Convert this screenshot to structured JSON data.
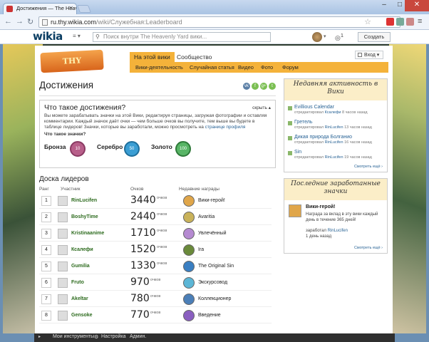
{
  "browser": {
    "tab_title": "Достижения — The Heavenly",
    "url_main": "ru.thy.wikia.com",
    "url_path": "/wiki/Служебная:Leaderboard",
    "min": "–",
    "max": "□",
    "close": "✕"
  },
  "wikia": {
    "logo": "wikia",
    "search_placeholder": "Поиск внутри The Heavenly Yard вики...",
    "notif_count": "1",
    "create_wiki": "Создать вики"
  },
  "wiki": {
    "logo_text": "THY",
    "tabs": [
      "На этой вики",
      "Сообщество"
    ],
    "subnav": [
      "Вики-деятельность",
      "Случайная статья",
      "Видео",
      "Фото",
      "Форум"
    ],
    "login": "Вход"
  },
  "content": {
    "title": "Достижения",
    "social": [
      "vk",
      "f",
      "g+",
      "t"
    ],
    "what": {
      "title": "Что такое достижения?",
      "hide": "скрыть",
      "desc": "Вы можете зарабатывать значки на этой Вики, редактируя страницы, загружая фотографии и оставляя комментарии. Каждый значок даёт очки — чем больше очков вы получите, тем выше вы будете в таблице лидеров! Значки, которые вы заработали, можно просмотреть на ",
      "desc_link": "странице профиля",
      "sub": "Что такое значки?",
      "medals": [
        {
          "label": "Бронза",
          "badge": "10",
          "color": "#b85f8a"
        },
        {
          "label": "Серебро",
          "badge": "50",
          "color": "#3b9ed4"
        },
        {
          "label": "Золото",
          "badge": "100",
          "color": "#58b566"
        }
      ]
    },
    "leaderboard": {
      "title": "Доска лидеров",
      "headers": {
        "rank": "Ранг",
        "user": "Участник",
        "points": "Очков",
        "recent": "Недавние награды"
      },
      "points_label": "очков",
      "rows": [
        {
          "rank": "1",
          "user": "RinLucifen",
          "points": "3440",
          "badge": "Вики-герой!",
          "bcolor": "#e0a64a"
        },
        {
          "rank": "2",
          "user": "BoshyTime",
          "points": "2440",
          "badge": "Avaritia",
          "bcolor": "#c9b25a"
        },
        {
          "rank": "3",
          "user": "Kristinaanime",
          "points": "1710",
          "badge": "Увлечённый",
          "bcolor": "#b58ad1"
        },
        {
          "rank": "4",
          "user": "Ксалефи",
          "points": "1520",
          "badge": "Ira",
          "bcolor": "#6a8a3a"
        },
        {
          "rank": "5",
          "user": "Gumilia",
          "points": "1330",
          "badge": "The Original Sin",
          "bcolor": "#3a7fc2"
        },
        {
          "rank": "6",
          "user": "Fruto",
          "points": "970",
          "badge": "Экскурсовод",
          "bcolor": "#5cb6d6"
        },
        {
          "rank": "7",
          "user": "Akeltar",
          "points": "780",
          "badge": "Коллекционер",
          "bcolor": "#4b7fb8"
        },
        {
          "rank": "8",
          "user": "Gensoke",
          "points": "770",
          "badge": "Введение",
          "bcolor": "#8a5fc0"
        }
      ]
    }
  },
  "rail": {
    "activity": {
      "title": "Недавняя активность в Вики",
      "items": [
        {
          "title": "Evillious Calendar",
          "meta": "отредактировал",
          "user": "Ксалефи",
          "ago": "8 часов назад"
        },
        {
          "title": "Гретель",
          "meta": "отредактировал",
          "user": "RinLucifen",
          "ago": "13 часов назад"
        },
        {
          "title": "Дикая природа Болганио",
          "meta": "отредактировал",
          "user": "RinLucifen",
          "ago": "16 часов назад"
        },
        {
          "title": "Sin",
          "meta": "отредактировал",
          "user": "RinLucifen",
          "ago": "19 часов назад"
        }
      ],
      "more": "Смотреть ещё ›"
    },
    "badges": {
      "title": "Последние заработанные значки",
      "badge_title": "Вики-герой!",
      "desc": "Награда за вклад в эту вики каждый день в течение 365 дней!",
      "earned": "заработал",
      "user": "RinLucifen",
      "ago": "1 день назад",
      "more": "Смотреть ещё ›"
    }
  },
  "bottom": {
    "tools": "Мои инструменты",
    "settings": "Настройка",
    "admin": "Админ."
  }
}
